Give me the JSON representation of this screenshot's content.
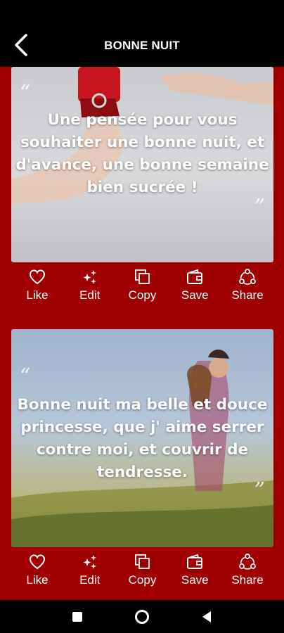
{
  "header": {
    "title": "BONNE NUIT",
    "back_icon": "back-arrow-icon"
  },
  "cards": [
    {
      "quote": "Une pensée pour vous souhaiter une bonne nuit, et d'avance, une bonne semaine bien sucrée !",
      "open_quote": "“",
      "close_quote": "”"
    },
    {
      "quote": "Bonne nuit ma belle et douce princesse, que j' aime serrer contre moi, et couvrir de tendresse.",
      "open_quote": "“",
      "close_quote": "”"
    }
  ],
  "actions": {
    "like": "Like",
    "edit": "Edit",
    "copy": "Copy",
    "save": "Save",
    "share": "Share"
  },
  "colors": {
    "accent": "#a00000",
    "topbar": "#000000",
    "text": "#ffffff"
  }
}
